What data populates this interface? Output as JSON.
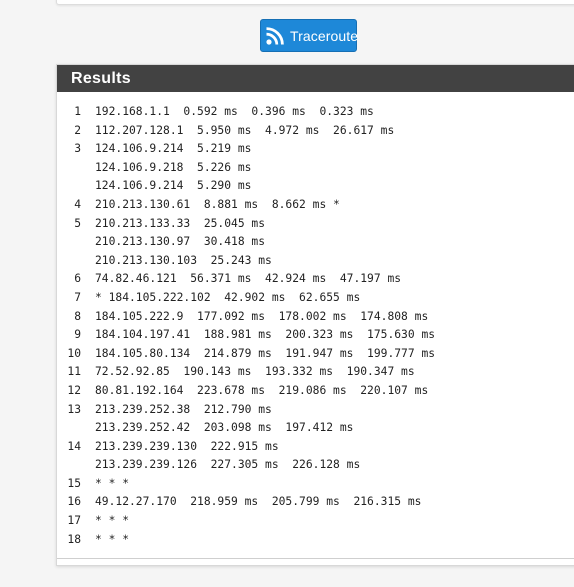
{
  "toolbar": {
    "traceroute_label": "Traceroute",
    "button_color": "#1e88d8",
    "icon": "rss-icon"
  },
  "results": {
    "title": "Results",
    "header_color": "#424242",
    "lines": [
      {
        "hop": "1",
        "text": "192.168.1.1  0.592 ms  0.396 ms  0.323 ms"
      },
      {
        "hop": "2",
        "text": "112.207.128.1  5.950 ms  4.972 ms  26.617 ms"
      },
      {
        "hop": "3",
        "text": "124.106.9.214  5.219 ms"
      },
      {
        "hop": "",
        "text": "124.106.9.218  5.226 ms"
      },
      {
        "hop": "",
        "text": "124.106.9.214  5.290 ms"
      },
      {
        "hop": "4",
        "text": "210.213.130.61  8.881 ms  8.662 ms *"
      },
      {
        "hop": "5",
        "text": "210.213.133.33  25.045 ms"
      },
      {
        "hop": "",
        "text": "210.213.130.97  30.418 ms"
      },
      {
        "hop": "",
        "text": "210.213.130.103  25.243 ms"
      },
      {
        "hop": "6",
        "text": "74.82.46.121  56.371 ms  42.924 ms  47.197 ms"
      },
      {
        "hop": "7",
        "text": "* 184.105.222.102  42.902 ms  62.655 ms"
      },
      {
        "hop": "8",
        "text": "184.105.222.9  177.092 ms  178.002 ms  174.808 ms"
      },
      {
        "hop": "9",
        "text": "184.104.197.41  188.981 ms  200.323 ms  175.630 ms"
      },
      {
        "hop": "10",
        "text": "184.105.80.134  214.879 ms  191.947 ms  199.777 ms"
      },
      {
        "hop": "11",
        "text": "72.52.92.85  190.143 ms  193.332 ms  190.347 ms"
      },
      {
        "hop": "12",
        "text": "80.81.192.164  223.678 ms  219.086 ms  220.107 ms"
      },
      {
        "hop": "13",
        "text": "213.239.252.38  212.790 ms"
      },
      {
        "hop": "",
        "text": "213.239.252.42  203.098 ms  197.412 ms"
      },
      {
        "hop": "14",
        "text": "213.239.239.130  222.915 ms"
      },
      {
        "hop": "",
        "text": "213.239.239.126  227.305 ms  226.128 ms"
      },
      {
        "hop": "15",
        "text": "* * *"
      },
      {
        "hop": "16",
        "text": "49.12.27.170  218.959 ms  205.799 ms  216.315 ms"
      },
      {
        "hop": "17",
        "text": "* * *"
      },
      {
        "hop": "18",
        "text": "* * *"
      }
    ]
  }
}
